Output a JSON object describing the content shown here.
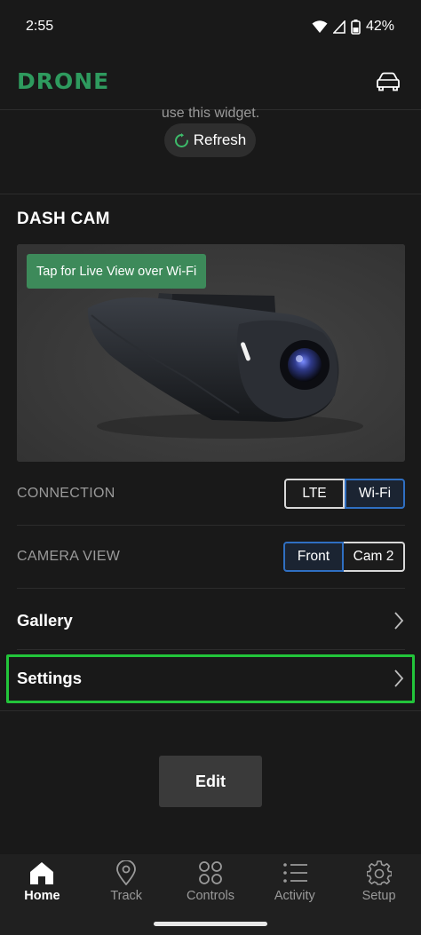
{
  "status_bar": {
    "time": "2:55",
    "battery": "42%"
  },
  "header": {
    "logo": "DRONE",
    "car_icon": "car-icon"
  },
  "widget_notice": {
    "truncated_text": "use this widget.",
    "refresh_label": "Refresh"
  },
  "dash_cam": {
    "title": "DASH CAM",
    "live_view_label": "Tap for Live View over Wi-Fi",
    "connection": {
      "label": "CONNECTION",
      "options": [
        "LTE",
        "Wi-Fi"
      ],
      "selected": "Wi-Fi"
    },
    "camera_view": {
      "label": "CAMERA VIEW",
      "options": [
        "Front",
        "Cam 2"
      ],
      "selected": "Front"
    },
    "gallery_label": "Gallery",
    "settings_label": "Settings"
  },
  "edit_label": "Edit",
  "bottom_nav": {
    "items": [
      {
        "label": "Home",
        "icon": "home-icon",
        "active": true
      },
      {
        "label": "Track",
        "icon": "location-pin-icon",
        "active": false
      },
      {
        "label": "Controls",
        "icon": "controls-icon",
        "active": false
      },
      {
        "label": "Activity",
        "icon": "list-icon",
        "active": false
      },
      {
        "label": "Setup",
        "icon": "gear-icon",
        "active": false
      }
    ]
  },
  "colors": {
    "background": "#191919",
    "brand_green": "#2e9a5e",
    "live_badge_green": "#3d8a5a",
    "selected_blue": "#2f6fc2",
    "highlight_green": "#22c53a"
  }
}
